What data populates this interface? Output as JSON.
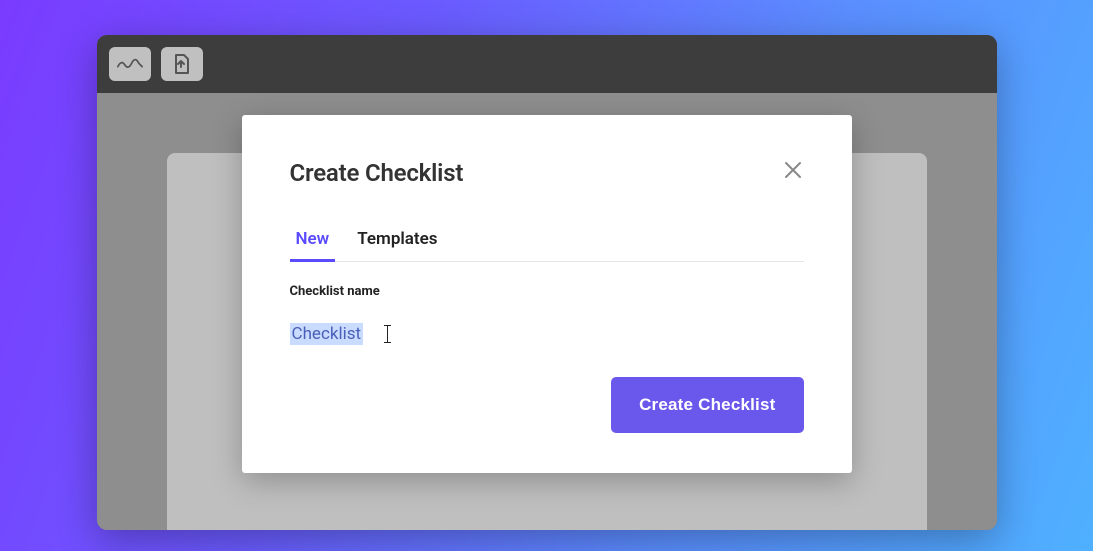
{
  "modal": {
    "title": "Create Checklist",
    "tabs": [
      {
        "label": "New",
        "active": true
      },
      {
        "label": "Templates",
        "active": false
      }
    ],
    "field_label": "Checklist name",
    "field_value": "Checklist",
    "submit_label": "Create Checklist"
  },
  "colors": {
    "accent": "#6a58ec",
    "tab_active": "#5b4bff"
  }
}
